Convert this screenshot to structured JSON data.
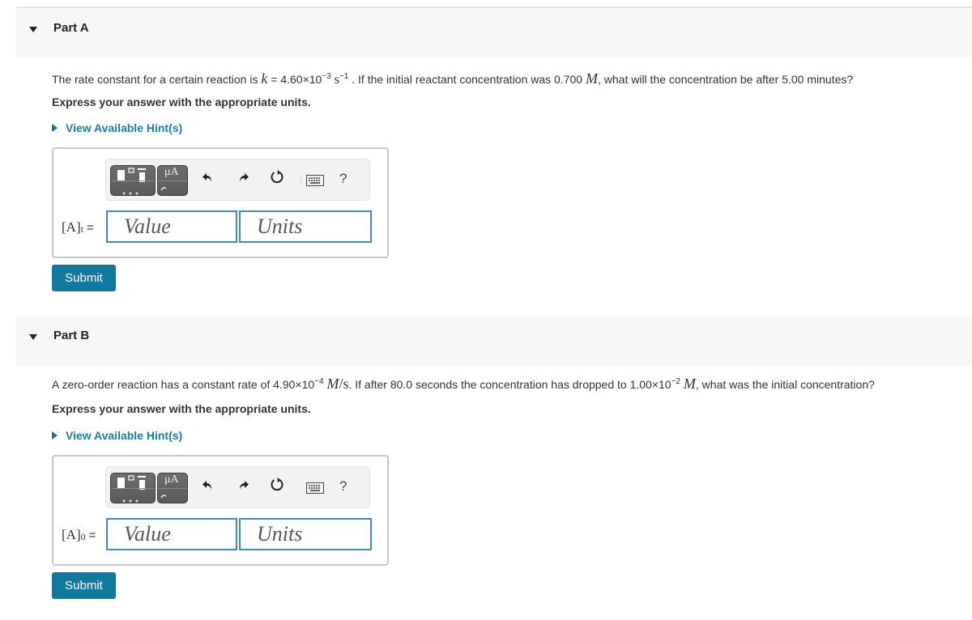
{
  "parts": [
    {
      "title": "Part A",
      "question": {
        "pre": "The rate constant for a certain reaction is ",
        "k_symbol": "k",
        "k_eq": " = 4.60×10",
        "k_exp": "−3",
        "k_unit": " s",
        "k_unit_exp": "−1",
        "mid": " . If the initial reactant concentration was 0.700 ",
        "conc_symbol": "M",
        "post": ", what will the concentration be after 5.00 minutes?"
      },
      "instruction": "Express your answer with the appropriate units.",
      "hint_label": "View Available Hint(s)",
      "answer_label": "[A]",
      "answer_sub": "t",
      "equals": "=",
      "value_placeholder": "Value",
      "units_placeholder": "Units",
      "submit_label": "Submit"
    },
    {
      "title": "Part B",
      "question": {
        "pre": "A zero-order reaction has a constant rate of 4.90×10",
        "rate_exp": "−4",
        "rate_unit_pre": " ",
        "rate_unit": "M",
        "rate_unit_post": "/s",
        "mid": ". If after 80.0 seconds the concentration has dropped to 1.00×10",
        "conc_exp": "−2",
        "conc_symbol": "M",
        "post": ", what was the initial concentration?"
      },
      "instruction": "Express your answer with the appropriate units.",
      "hint_label": "View Available Hint(s)",
      "answer_label": "[A]",
      "answer_sub": "0",
      "equals": "=",
      "value_placeholder": "Value",
      "units_placeholder": "Units",
      "submit_label": "Submit"
    }
  ],
  "toolbar": {
    "units_button_label": "μA",
    "undo_icon": "↶",
    "redo_icon": "↷",
    "reset_icon": "↻",
    "keyboard_icon": "⌨",
    "help_icon": "?"
  },
  "colors": {
    "accent": "#12799e",
    "link": "#1a7fa3",
    "field_border": "#3d8eb0",
    "header_bg": "#f7f7f7"
  }
}
